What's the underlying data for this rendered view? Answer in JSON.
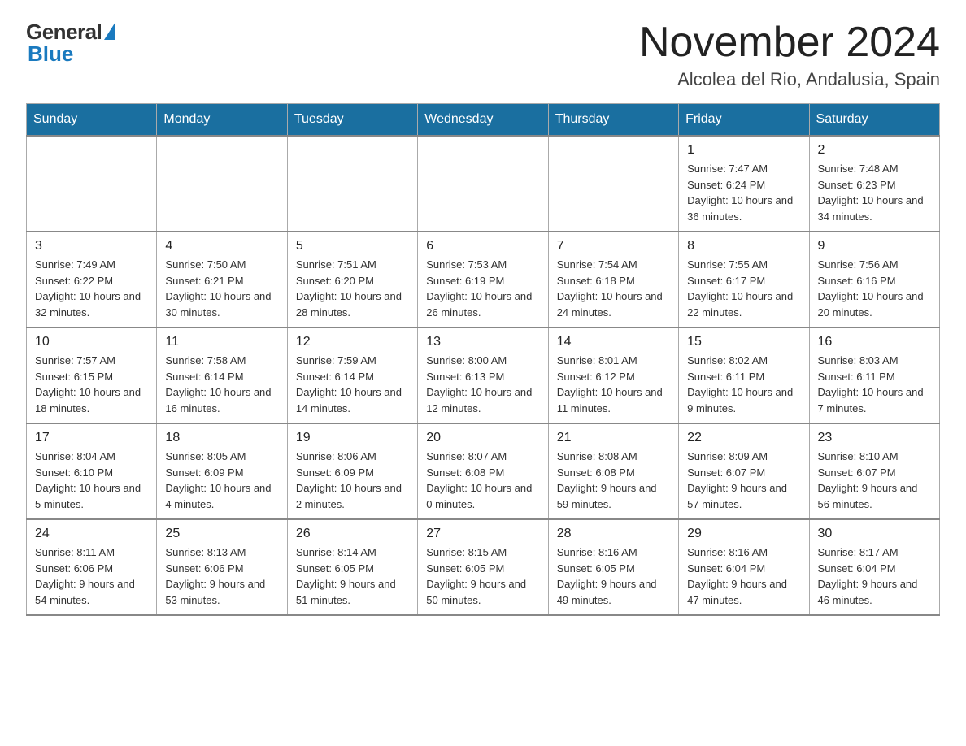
{
  "logo": {
    "general_text": "General",
    "blue_text": "Blue"
  },
  "title": "November 2024",
  "location": "Alcolea del Rio, Andalusia, Spain",
  "weekdays": [
    "Sunday",
    "Monday",
    "Tuesday",
    "Wednesday",
    "Thursday",
    "Friday",
    "Saturday"
  ],
  "weeks": [
    [
      {
        "day": "",
        "info": ""
      },
      {
        "day": "",
        "info": ""
      },
      {
        "day": "",
        "info": ""
      },
      {
        "day": "",
        "info": ""
      },
      {
        "day": "",
        "info": ""
      },
      {
        "day": "1",
        "info": "Sunrise: 7:47 AM\nSunset: 6:24 PM\nDaylight: 10 hours and 36 minutes."
      },
      {
        "day": "2",
        "info": "Sunrise: 7:48 AM\nSunset: 6:23 PM\nDaylight: 10 hours and 34 minutes."
      }
    ],
    [
      {
        "day": "3",
        "info": "Sunrise: 7:49 AM\nSunset: 6:22 PM\nDaylight: 10 hours and 32 minutes."
      },
      {
        "day": "4",
        "info": "Sunrise: 7:50 AM\nSunset: 6:21 PM\nDaylight: 10 hours and 30 minutes."
      },
      {
        "day": "5",
        "info": "Sunrise: 7:51 AM\nSunset: 6:20 PM\nDaylight: 10 hours and 28 minutes."
      },
      {
        "day": "6",
        "info": "Sunrise: 7:53 AM\nSunset: 6:19 PM\nDaylight: 10 hours and 26 minutes."
      },
      {
        "day": "7",
        "info": "Sunrise: 7:54 AM\nSunset: 6:18 PM\nDaylight: 10 hours and 24 minutes."
      },
      {
        "day": "8",
        "info": "Sunrise: 7:55 AM\nSunset: 6:17 PM\nDaylight: 10 hours and 22 minutes."
      },
      {
        "day": "9",
        "info": "Sunrise: 7:56 AM\nSunset: 6:16 PM\nDaylight: 10 hours and 20 minutes."
      }
    ],
    [
      {
        "day": "10",
        "info": "Sunrise: 7:57 AM\nSunset: 6:15 PM\nDaylight: 10 hours and 18 minutes."
      },
      {
        "day": "11",
        "info": "Sunrise: 7:58 AM\nSunset: 6:14 PM\nDaylight: 10 hours and 16 minutes."
      },
      {
        "day": "12",
        "info": "Sunrise: 7:59 AM\nSunset: 6:14 PM\nDaylight: 10 hours and 14 minutes."
      },
      {
        "day": "13",
        "info": "Sunrise: 8:00 AM\nSunset: 6:13 PM\nDaylight: 10 hours and 12 minutes."
      },
      {
        "day": "14",
        "info": "Sunrise: 8:01 AM\nSunset: 6:12 PM\nDaylight: 10 hours and 11 minutes."
      },
      {
        "day": "15",
        "info": "Sunrise: 8:02 AM\nSunset: 6:11 PM\nDaylight: 10 hours and 9 minutes."
      },
      {
        "day": "16",
        "info": "Sunrise: 8:03 AM\nSunset: 6:11 PM\nDaylight: 10 hours and 7 minutes."
      }
    ],
    [
      {
        "day": "17",
        "info": "Sunrise: 8:04 AM\nSunset: 6:10 PM\nDaylight: 10 hours and 5 minutes."
      },
      {
        "day": "18",
        "info": "Sunrise: 8:05 AM\nSunset: 6:09 PM\nDaylight: 10 hours and 4 minutes."
      },
      {
        "day": "19",
        "info": "Sunrise: 8:06 AM\nSunset: 6:09 PM\nDaylight: 10 hours and 2 minutes."
      },
      {
        "day": "20",
        "info": "Sunrise: 8:07 AM\nSunset: 6:08 PM\nDaylight: 10 hours and 0 minutes."
      },
      {
        "day": "21",
        "info": "Sunrise: 8:08 AM\nSunset: 6:08 PM\nDaylight: 9 hours and 59 minutes."
      },
      {
        "day": "22",
        "info": "Sunrise: 8:09 AM\nSunset: 6:07 PM\nDaylight: 9 hours and 57 minutes."
      },
      {
        "day": "23",
        "info": "Sunrise: 8:10 AM\nSunset: 6:07 PM\nDaylight: 9 hours and 56 minutes."
      }
    ],
    [
      {
        "day": "24",
        "info": "Sunrise: 8:11 AM\nSunset: 6:06 PM\nDaylight: 9 hours and 54 minutes."
      },
      {
        "day": "25",
        "info": "Sunrise: 8:13 AM\nSunset: 6:06 PM\nDaylight: 9 hours and 53 minutes."
      },
      {
        "day": "26",
        "info": "Sunrise: 8:14 AM\nSunset: 6:05 PM\nDaylight: 9 hours and 51 minutes."
      },
      {
        "day": "27",
        "info": "Sunrise: 8:15 AM\nSunset: 6:05 PM\nDaylight: 9 hours and 50 minutes."
      },
      {
        "day": "28",
        "info": "Sunrise: 8:16 AM\nSunset: 6:05 PM\nDaylight: 9 hours and 49 minutes."
      },
      {
        "day": "29",
        "info": "Sunrise: 8:16 AM\nSunset: 6:04 PM\nDaylight: 9 hours and 47 minutes."
      },
      {
        "day": "30",
        "info": "Sunrise: 8:17 AM\nSunset: 6:04 PM\nDaylight: 9 hours and 46 minutes."
      }
    ]
  ]
}
